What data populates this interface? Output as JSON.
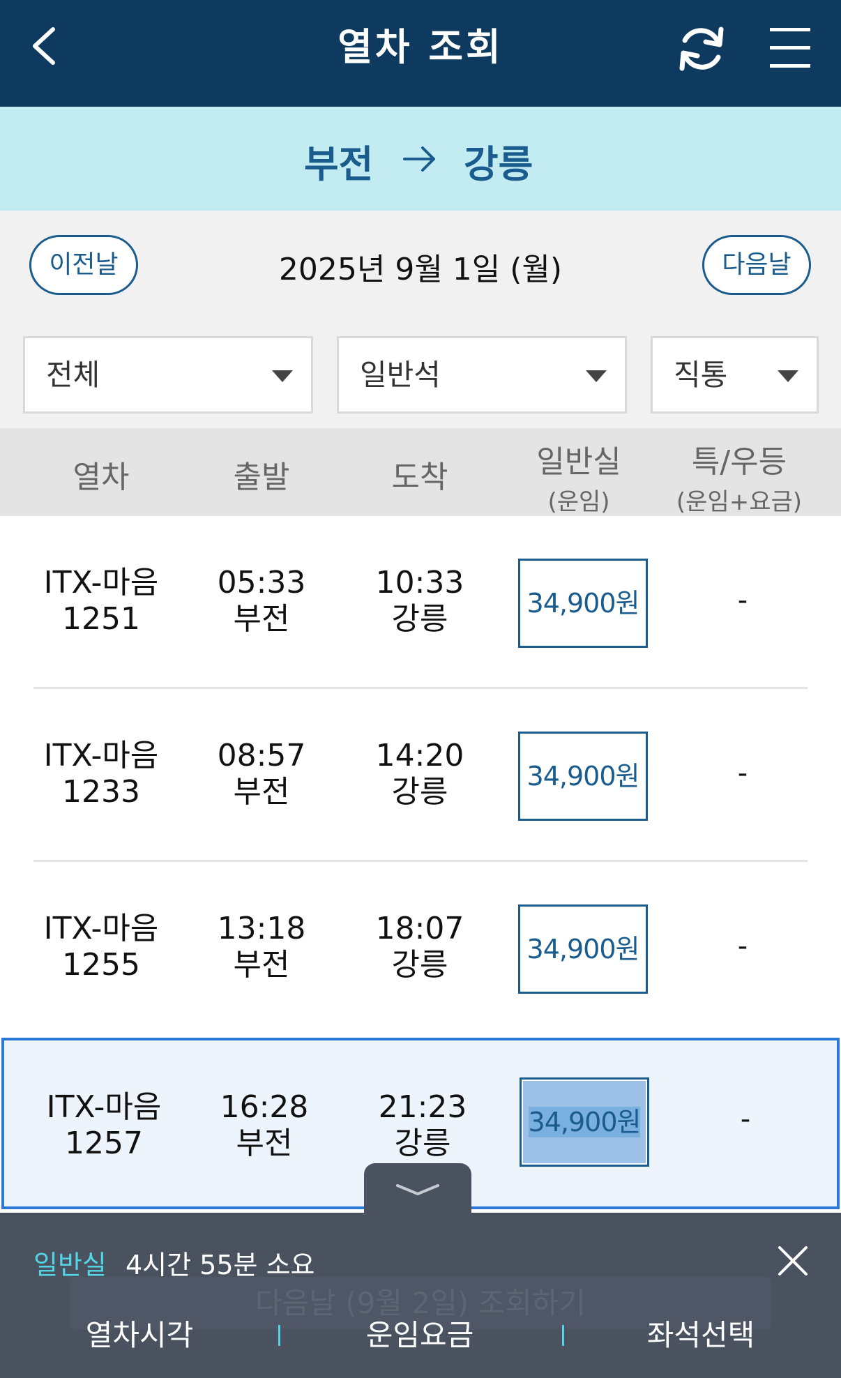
{
  "header": {
    "title": "열차 조회",
    "icons": {
      "back": "chevron-left-icon",
      "refresh": "refresh-icon",
      "menu": "hamburger-menu-icon"
    }
  },
  "route": {
    "from": "부전",
    "to": "강릉"
  },
  "date_nav": {
    "prev_label": "이전날",
    "date": "2025년 9월 1일 (월)",
    "next_label": "다음날"
  },
  "filters": [
    {
      "selected": "전체"
    },
    {
      "selected": "일반석"
    },
    {
      "selected": "직통"
    }
  ],
  "table": {
    "headers": {
      "train": "열차",
      "departure": "출발",
      "arrival": "도착",
      "general_main": "일반실",
      "general_sub": "(운임)",
      "special_main": "특/우등",
      "special_sub": "(운임+요금)"
    },
    "rows": [
      {
        "train_name": "ITX-마음",
        "train_no": "1251",
        "dep_time": "05:33",
        "dep_station": "부전",
        "arr_time": "10:33",
        "arr_station": "강릉",
        "fare": "34,900원",
        "special": "-",
        "selected": false
      },
      {
        "train_name": "ITX-마음",
        "train_no": "1233",
        "dep_time": "08:57",
        "dep_station": "부전",
        "arr_time": "14:20",
        "arr_station": "강릉",
        "fare": "34,900원",
        "special": "-",
        "selected": false
      },
      {
        "train_name": "ITX-마음",
        "train_no": "1255",
        "dep_time": "13:18",
        "dep_station": "부전",
        "arr_time": "18:07",
        "arr_station": "강릉",
        "fare": "34,900원",
        "special": "-",
        "selected": false
      },
      {
        "train_name": "ITX-마음",
        "train_no": "1257",
        "dep_time": "16:28",
        "dep_station": "부전",
        "arr_time": "21:23",
        "arr_station": "강릉",
        "fare": "34,900원",
        "special": "-",
        "selected": true
      }
    ]
  },
  "bottom_panel": {
    "class_label": "일반실",
    "duration": "4시간 55분 소요",
    "behind_text": "다음날 (9월 2일) 조회하기",
    "tabs": [
      "열차시각",
      "운임요금",
      "좌석선택"
    ]
  },
  "colors": {
    "header_bg": "#0e3a60",
    "route_bg": "#c3ecf2",
    "accent": "#1a5c8d",
    "selected_border": "#2b78d6",
    "panel_bg": "#4a5260",
    "panel_accent": "#52d6e6"
  }
}
